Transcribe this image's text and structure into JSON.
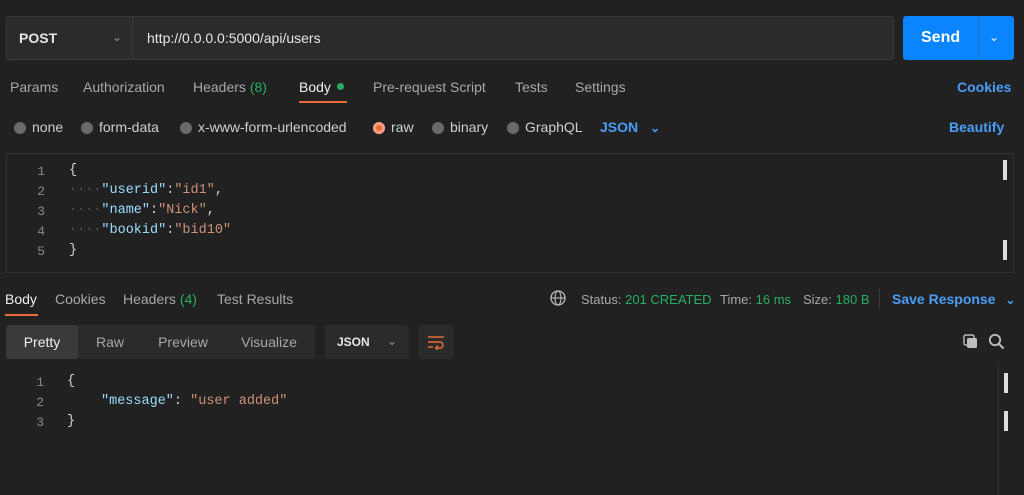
{
  "request": {
    "method": "POST",
    "url": "http://0.0.0.0:5000/api/users",
    "send_label": "Send"
  },
  "tabs": {
    "params": "Params",
    "authorization": "Authorization",
    "headers": "Headers",
    "headers_count": "(8)",
    "body": "Body",
    "prerequest": "Pre-request Script",
    "tests": "Tests",
    "settings": "Settings",
    "cookies": "Cookies"
  },
  "body_types": {
    "none": "none",
    "form_data": "form-data",
    "urlencoded": "x-www-form-urlencoded",
    "raw": "raw",
    "binary": "binary",
    "graphql": "GraphQL",
    "format": "JSON",
    "beautify": "Beautify",
    "selected": "raw"
  },
  "request_body": {
    "line_numbers": [
      "1",
      "2",
      "3",
      "4",
      "5"
    ],
    "open_brace": "{",
    "close_brace": "}",
    "fields": [
      {
        "key": "\"userid\"",
        "value": "\"id1\"",
        "sep": ",",
        "colon": ":"
      },
      {
        "key": "\"name\"",
        "value": "\"Nick\"",
        "sep": ",",
        "colon": ":"
      },
      {
        "key": "\"bookid\"",
        "value": "\"bid10\"",
        "sep": "",
        "colon": ":"
      }
    ]
  },
  "response_tabs": {
    "body": "Body",
    "cookies": "Cookies",
    "headers": "Headers",
    "headers_count": "(4)",
    "test_results": "Test Results"
  },
  "response_meta": {
    "status_label": "Status:",
    "status_value": "201 CREATED",
    "time_label": "Time:",
    "time_value": "16 ms",
    "size_label": "Size:",
    "size_value": "180 B",
    "save_response": "Save Response"
  },
  "view_modes": {
    "pretty": "Pretty",
    "raw": "Raw",
    "preview": "Preview",
    "visualize": "Visualize",
    "format": "JSON"
  },
  "response_body": {
    "line_numbers": [
      "1",
      "2",
      "3"
    ],
    "open_brace": "{",
    "close_brace": "}",
    "key": "\"message\"",
    "colon": ": ",
    "value": "\"user added\""
  },
  "colors": {
    "accent_orange": "#e86c3a",
    "link_blue": "#4a9df8",
    "send_blue": "#0a84ff",
    "status_green": "#27ae60"
  }
}
